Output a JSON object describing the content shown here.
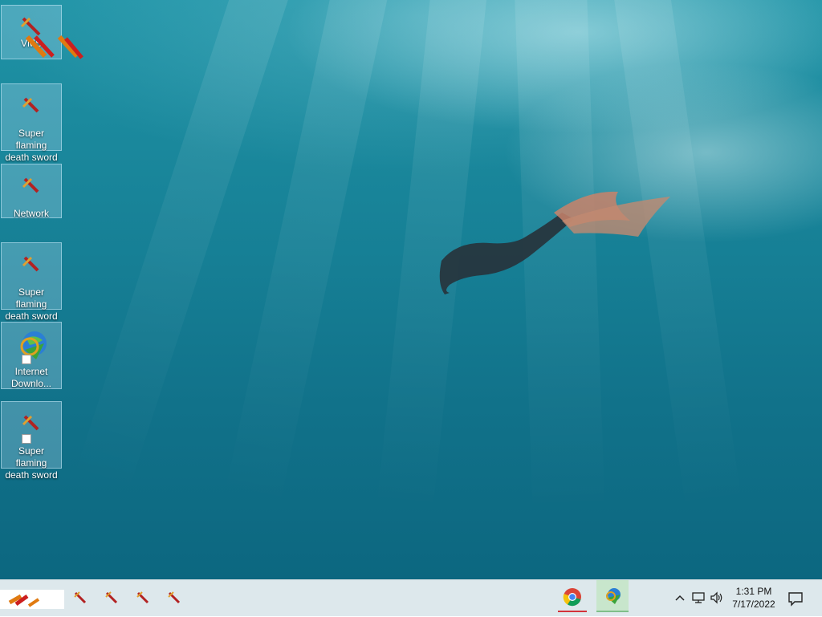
{
  "desktop": {
    "icons": [
      {
        "label": "VMS"
      },
      {
        "label": "Super flaming death sword"
      },
      {
        "label": "Network"
      },
      {
        "label": "Super flaming death sword"
      },
      {
        "label": "Internet Downlo..."
      },
      {
        "label": "Super flaming death sword"
      }
    ]
  },
  "taskbar": {
    "pinned_icons": [
      "sword-icon",
      "sword-icon",
      "sword-icon",
      "sword-icon"
    ],
    "apps": [
      {
        "name": "chrome-icon",
        "accent": "#d3333a"
      },
      {
        "name": "internet-download-manager-icon",
        "accent": "#7fbf8a"
      }
    ],
    "tray": {
      "icons": [
        "chevron-up-icon",
        "network-icon",
        "volume-icon"
      ],
      "time": "1:31 PM",
      "date": "7/17/2022",
      "notification_icon": "action-center-icon"
    }
  },
  "colors": {
    "taskbar_bg": "#dde8ec",
    "icon_selection": "#aad7eb",
    "water_deep": "#0c6780",
    "water_light": "#1f93a6"
  }
}
